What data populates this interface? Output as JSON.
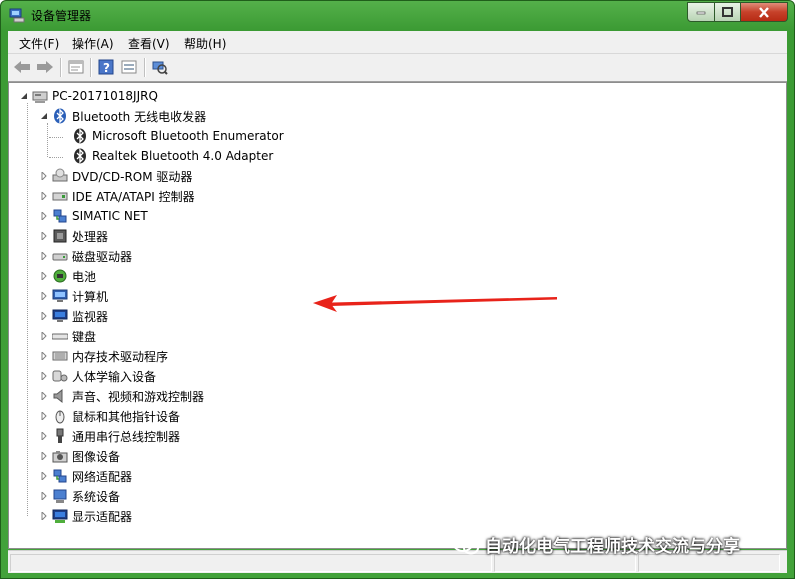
{
  "window": {
    "title": "设备管理器"
  },
  "menu": [
    "文件(F)",
    "操作(A)",
    "查看(V)",
    "帮助(H)"
  ],
  "toolbar": [
    "back-icon",
    "forward-icon",
    "properties-icon",
    "help-icon",
    "view-icon",
    "scan-hardware-icon"
  ],
  "tree": {
    "root": "PC-20171018JJRQ",
    "bluetooth": {
      "label": "Bluetooth 无线电收发器",
      "children": [
        "Microsoft Bluetooth Enumerator",
        "Realtek Bluetooth 4.0 Adapter"
      ]
    },
    "categories": [
      "DVD/CD-ROM 驱动器",
      "IDE ATA/ATAPI 控制器",
      "SIMATIC NET",
      "处理器",
      "磁盘驱动器",
      "电池",
      "计算机",
      "监视器",
      "键盘",
      "内存技术驱动程序",
      "人体学输入设备",
      "声音、视频和游戏控制器",
      "鼠标和其他指针设备",
      "通用串行总线控制器",
      "图像设备",
      "网络适配器",
      "系统设备",
      "显示适配器"
    ]
  },
  "watermark": "自动化电气工程师技术交流与分享",
  "colors": {
    "titlebar": "#46a53d",
    "arrow": "#e8231a",
    "close": "#c6412a"
  }
}
